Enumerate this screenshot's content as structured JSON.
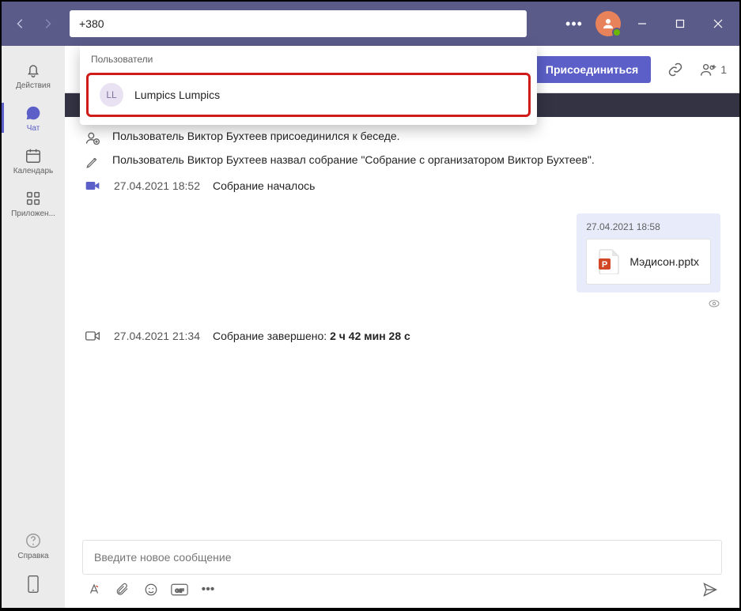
{
  "titlebar": {
    "search_value": "+380"
  },
  "sidebar": {
    "items": [
      {
        "label": "Действия"
      },
      {
        "label": "Чат"
      },
      {
        "label": "Календарь"
      },
      {
        "label": "Приложен..."
      }
    ],
    "help_label": "Справка"
  },
  "header": {
    "join_label": "Присоединиться",
    "participants_count": "1"
  },
  "dropdown": {
    "section_label": "Пользователи",
    "result_initials": "LL",
    "result_name": "Lumpics Lumpics"
  },
  "chat": {
    "joined_text": "Пользователь Виктор Бухтеев присоединился к беседе.",
    "named_text": "Пользователь Виктор Бухтеев назвал собрание \"Собрание с организатором Виктор Бухтеев\".",
    "start_time": "27.04.2021 18:52",
    "start_label": "Собрание началось",
    "message_time": "27.04.2021 18:58",
    "file_name": "Мэдисон.pptx",
    "end_time": "27.04.2021 21:34",
    "end_label_prefix": "Собрание завершено: ",
    "end_duration": "2 ч 42 мин 28 с"
  },
  "compose": {
    "placeholder": "Введите новое сообщение"
  }
}
